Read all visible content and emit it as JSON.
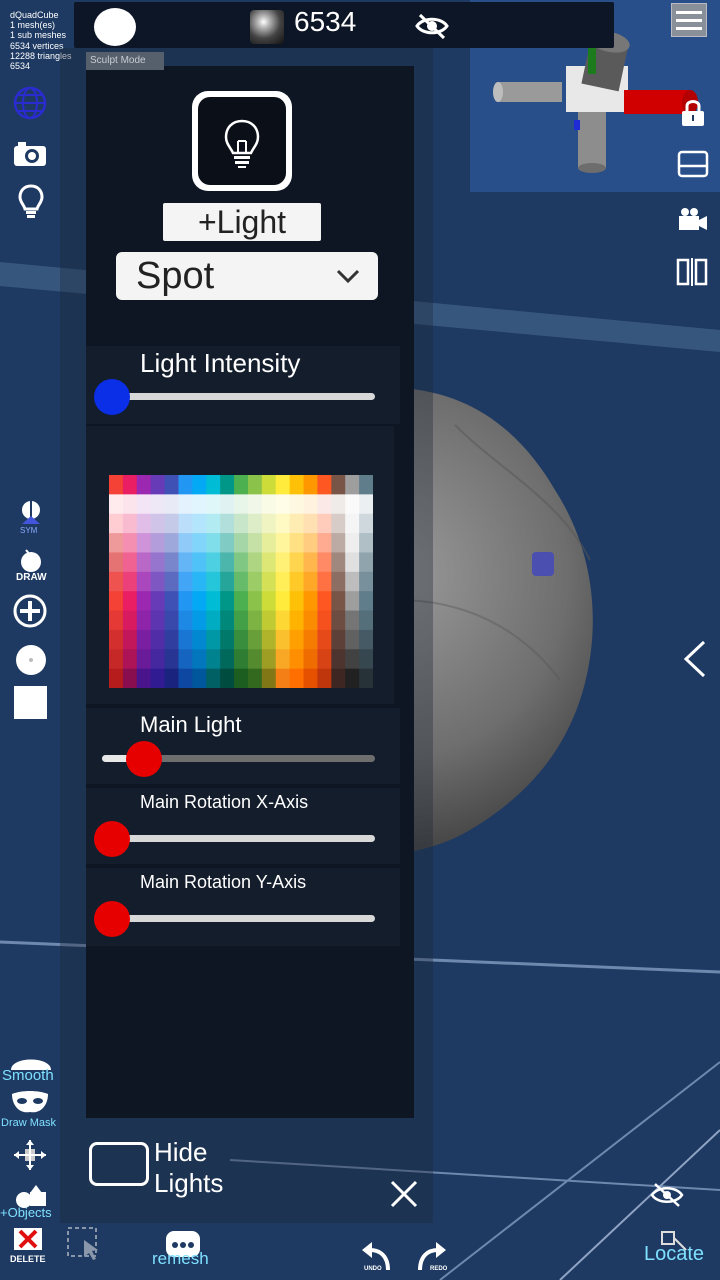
{
  "stats": {
    "lines": [
      "dQuadCube",
      "1 mesh(es)",
      "1 sub meshes",
      "6534 vertices",
      "12288 triangles",
      "6534"
    ]
  },
  "top_bar": {
    "vertex_count": "6534"
  },
  "mode_label": "Sculpt Mode",
  "left_toolbar": {
    "sym_label": "SYM",
    "draw_label": "DRAW",
    "smooth_label": "Smooth",
    "draw_mask_label": "Draw Mask",
    "objects_label": "+Objects",
    "delete_label": "DELETE"
  },
  "bottom_bar": {
    "remesh_label": "remesh",
    "undo_label": "UNDO",
    "redo_label": "REDO",
    "locate_label": "Locate"
  },
  "light_panel": {
    "add_light_label": "+Light",
    "light_type": "Spot",
    "intensity": {
      "label": "Light Intensity",
      "value": 0.0
    },
    "main_light": {
      "label": "Main Light",
      "value": 0.15
    },
    "rotation_x": {
      "label": "Main Rotation X-Axis",
      "value": 0.0
    },
    "rotation_y": {
      "label": "Main Rotation Y-Axis",
      "value": 0.0
    },
    "hide_lights": {
      "label_line1": "Hide",
      "label_line2": "Lights",
      "checked": false
    }
  },
  "colors": {
    "intensity_knob": "#0a2fe6",
    "slider_knob": "#e60000",
    "accent_text": "#7fe0ff",
    "viewport_bg": "#1e3a62",
    "panel_bg": "#0e1624"
  },
  "palette": {
    "columns": [
      [
        "#f44336",
        "#ffebee",
        "#ffcdd2",
        "#ef9a9a",
        "#e57373",
        "#ef5350",
        "#f44336",
        "#e53935",
        "#d32f2f",
        "#c62828",
        "#b71c1c"
      ],
      [
        "#e91e63",
        "#fce4ec",
        "#f8bbd0",
        "#f48fb1",
        "#f06292",
        "#ec407a",
        "#e91e63",
        "#d81b60",
        "#c2185b",
        "#ad1457",
        "#880e4f"
      ],
      [
        "#9c27b0",
        "#f3e5f5",
        "#e1bee7",
        "#ce93d8",
        "#ba68c8",
        "#ab47bc",
        "#9c27b0",
        "#8e24aa",
        "#7b1fa2",
        "#6a1b9a",
        "#4a148c"
      ],
      [
        "#673ab7",
        "#ede7f6",
        "#d1c4e9",
        "#b39ddb",
        "#9575cd",
        "#7e57c2",
        "#673ab7",
        "#5e35b1",
        "#512da8",
        "#4527a0",
        "#311b92"
      ],
      [
        "#3f51b5",
        "#e8eaf6",
        "#c5cae9",
        "#9fa8da",
        "#7986cb",
        "#5c6bc0",
        "#3f51b5",
        "#3949ab",
        "#303f9f",
        "#283593",
        "#1a237e"
      ],
      [
        "#2196f3",
        "#e3f2fd",
        "#bbdefb",
        "#90caf9",
        "#64b5f6",
        "#42a5f5",
        "#2196f3",
        "#1e88e5",
        "#1976d2",
        "#1565c0",
        "#0d47a1"
      ],
      [
        "#03a9f4",
        "#e1f5fe",
        "#b3e5fc",
        "#81d4fa",
        "#4fc3f7",
        "#29b6f6",
        "#03a9f4",
        "#039be5",
        "#0288d1",
        "#0277bd",
        "#01579b"
      ],
      [
        "#00bcd4",
        "#e0f7fa",
        "#b2ebf2",
        "#80deea",
        "#4dd0e1",
        "#26c6da",
        "#00bcd4",
        "#00acc1",
        "#0097a7",
        "#00838f",
        "#006064"
      ],
      [
        "#009688",
        "#e0f2f1",
        "#b2dfdb",
        "#80cbc4",
        "#4db6ac",
        "#26a69a",
        "#009688",
        "#00897b",
        "#00796b",
        "#00695c",
        "#004d40"
      ],
      [
        "#4caf50",
        "#e8f5e9",
        "#c8e6c9",
        "#a5d6a7",
        "#81c784",
        "#66bb6a",
        "#4caf50",
        "#43a047",
        "#388e3c",
        "#2e7d32",
        "#1b5e20"
      ],
      [
        "#8bc34a",
        "#f1f8e9",
        "#dcedc8",
        "#c5e1a5",
        "#aed581",
        "#9ccc65",
        "#8bc34a",
        "#7cb342",
        "#689f38",
        "#558b2f",
        "#33691e"
      ],
      [
        "#cddc39",
        "#f9fbe7",
        "#f0f4c3",
        "#e6ee9c",
        "#dce775",
        "#d4e157",
        "#cddc39",
        "#c0ca33",
        "#afb42b",
        "#9e9d24",
        "#827717"
      ],
      [
        "#ffeb3b",
        "#fffde7",
        "#fff9c4",
        "#fff59d",
        "#fff176",
        "#ffee58",
        "#ffeb3b",
        "#fdd835",
        "#fbc02d",
        "#f9a825",
        "#f57f17"
      ],
      [
        "#ffc107",
        "#fff8e1",
        "#ffecb3",
        "#ffe082",
        "#ffd54f",
        "#ffca28",
        "#ffc107",
        "#ffb300",
        "#ffa000",
        "#ff8f00",
        "#ff6f00"
      ],
      [
        "#ff9800",
        "#fff3e0",
        "#ffe0b2",
        "#ffcc80",
        "#ffb74d",
        "#ffa726",
        "#ff9800",
        "#fb8c00",
        "#f57c00",
        "#ef6c00",
        "#e65100"
      ],
      [
        "#ff5722",
        "#fbe9e7",
        "#ffccbc",
        "#ffab91",
        "#ff8a65",
        "#ff7043",
        "#ff5722",
        "#f4511e",
        "#e64a19",
        "#d84315",
        "#bf360c"
      ],
      [
        "#795548",
        "#efebe9",
        "#d7ccc8",
        "#bcaaa4",
        "#a1887f",
        "#8d6e63",
        "#795548",
        "#6d4c41",
        "#5d4037",
        "#4e342e",
        "#3e2723"
      ],
      [
        "#9e9e9e",
        "#fafafa",
        "#f5f5f5",
        "#eeeeee",
        "#e0e0e0",
        "#bdbdbd",
        "#9e9e9e",
        "#757575",
        "#616161",
        "#424242",
        "#212121"
      ],
      [
        "#607d8b",
        "#eceff1",
        "#cfd8dc",
        "#b0bec5",
        "#90a4ae",
        "#78909c",
        "#607d8b",
        "#546e7a",
        "#455a64",
        "#37474f",
        "#263238"
      ]
    ]
  }
}
